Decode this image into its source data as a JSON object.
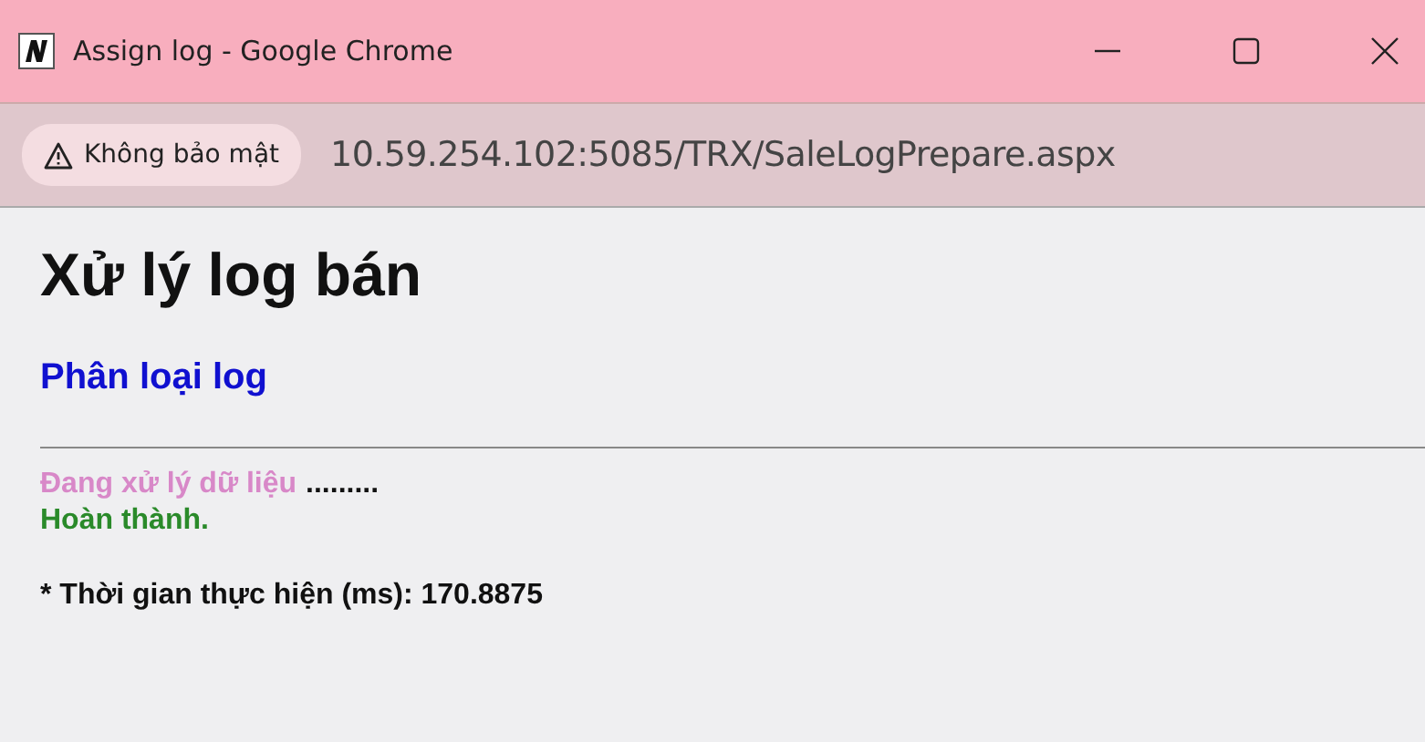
{
  "window": {
    "title": "Assign log - Google Chrome"
  },
  "address_bar": {
    "security_label": "Không bảo mật",
    "url": "10.59.254.102:5085/TRX/SaleLogPrepare.aspx"
  },
  "page": {
    "heading": "Xử lý log bán",
    "link": "Phân loại log",
    "status_lines": [
      {
        "kind": "progress",
        "label": "Đang xử lý dữ liệu",
        "dots": "........."
      },
      {
        "kind": "done",
        "label": "Hoàn thành."
      }
    ],
    "timing": "* Thời gian thực hiện (ms): 170.8875"
  }
}
